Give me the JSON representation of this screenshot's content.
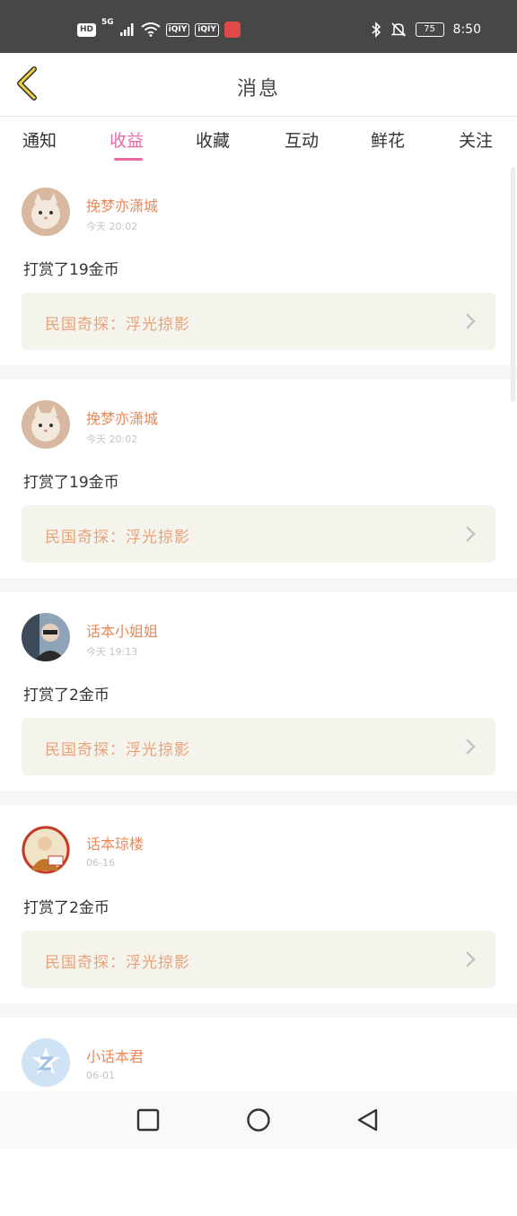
{
  "status_bar": {
    "time": "8:50",
    "battery": "75",
    "network": "5G",
    "hd": "HD",
    "tags": [
      "iQIY",
      "iQIY"
    ],
    "icons": [
      "signal-icon",
      "wifi-icon",
      "bluetooth-icon",
      "mute-icon",
      "battery-icon"
    ]
  },
  "header": {
    "title": "消息",
    "back_icon": "chevron-left-icon"
  },
  "tabs": [
    {
      "label": "通知"
    },
    {
      "label": "收益",
      "active": true
    },
    {
      "label": "收藏"
    },
    {
      "label": "互动"
    },
    {
      "label": "鲜花"
    },
    {
      "label": "关注"
    }
  ],
  "colors": {
    "accent": "#e86aa5",
    "username": "#e8895a",
    "book_title": "#e8a27b",
    "book_bg": "#f4f4ec"
  },
  "messages": [
    {
      "username": "挽梦亦潇城",
      "time": "今天 20:02",
      "text": "打赏了19金币",
      "book": "民国奇探：浮光掠影",
      "avatar": "cat-avatar"
    },
    {
      "username": "挽梦亦潇城",
      "time": "今天 20:02",
      "text": "打赏了19金币",
      "book": "民国奇探：浮光掠影",
      "avatar": "cat-avatar"
    },
    {
      "username": "话本小姐姐",
      "time": "今天 19:13",
      "text": "打赏了2金币",
      "book": "民国奇探：浮光掠影",
      "avatar": "person-avatar"
    },
    {
      "username": "话本琼楼",
      "time": "06-16",
      "text": "打赏了2金币",
      "book": "民国奇探：浮光掠影",
      "avatar": "art-avatar"
    },
    {
      "username": "小话本君",
      "time": "06-01",
      "text": "",
      "book": "",
      "avatar": "default-avatar"
    }
  ],
  "nav_bar": {
    "icons": [
      "recent-apps-icon",
      "home-icon",
      "back-icon"
    ]
  }
}
